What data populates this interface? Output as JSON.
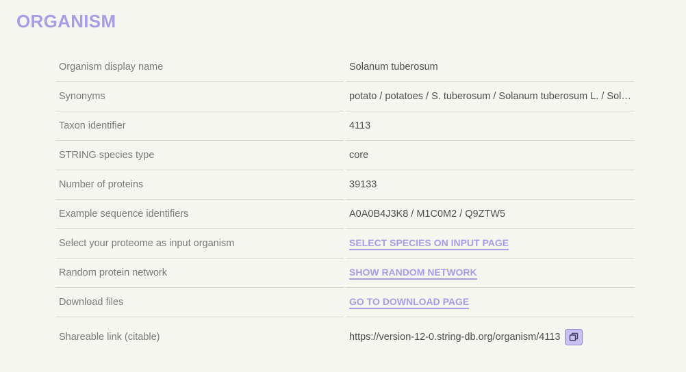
{
  "section": {
    "title": "ORGANISM"
  },
  "rows": [
    {
      "label": "Organism display name",
      "value": "Solanum tuberosum"
    },
    {
      "label": "Synonyms",
      "value": "potato / potatoes / S. tuberosum / Solanum tuberosum L. / Solan…"
    },
    {
      "label": "Taxon identifier",
      "value": "4113"
    },
    {
      "label": "STRING species type",
      "value": "core"
    },
    {
      "label": "Number of proteins",
      "value": "39133"
    },
    {
      "label": "Example sequence identifiers",
      "value": "A0A0B4J3K8 / M1C0M2 / Q9ZTW5"
    },
    {
      "label": "Select your proteome as input organism",
      "link": "SELECT SPECIES ON INPUT PAGE"
    },
    {
      "label": "Random protein network",
      "link": "SHOW RANDOM NETWORK"
    },
    {
      "label": "Download files",
      "link": "GO TO DOWNLOAD PAGE"
    },
    {
      "label": "Shareable link (citable)",
      "value": "https://version-12-0.string-db.org/organism/4113",
      "icon": "copy-icon"
    }
  ],
  "colors": {
    "accent": "#a99be6",
    "copy_button_bg": "#c9c1f1",
    "background": "#f6f6f1"
  }
}
